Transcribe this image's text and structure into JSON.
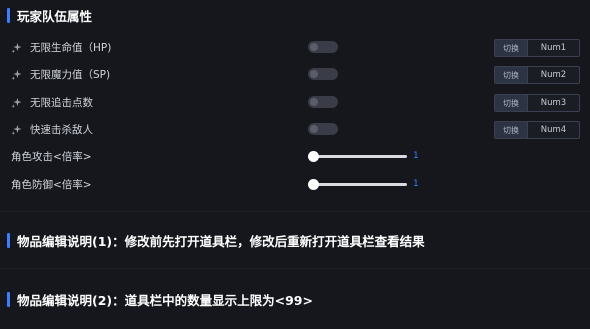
{
  "header": {
    "title": "玩家队伍属性"
  },
  "toggles": [
    {
      "label": "无限生命值（HP)",
      "switch_label": "切换",
      "hotkey": "Num1"
    },
    {
      "label": "无限魔力值（SP)",
      "switch_label": "切换",
      "hotkey": "Num2"
    },
    {
      "label": "无限追击点数",
      "switch_label": "切换",
      "hotkey": "Num3"
    },
    {
      "label": "快速击杀敌人",
      "switch_label": "切换",
      "hotkey": "Num4"
    }
  ],
  "sliders": [
    {
      "label": "角色攻击<倍率>",
      "value": "1",
      "level": 0
    },
    {
      "label": "角色防御<倍率>",
      "value": "1",
      "level": 0
    }
  ],
  "notes": [
    {
      "title": "物品编辑说明(1)：修改前先打开道具栏，修改后重新打开道具栏查看结果"
    },
    {
      "title": "物品编辑说明(2)：道具栏中的数量显示上限为<99>"
    }
  ],
  "colors": {
    "accent": "#3d7bff",
    "background": "#15171d"
  },
  "icons": {
    "toggle_row": "sparkle-icon"
  }
}
